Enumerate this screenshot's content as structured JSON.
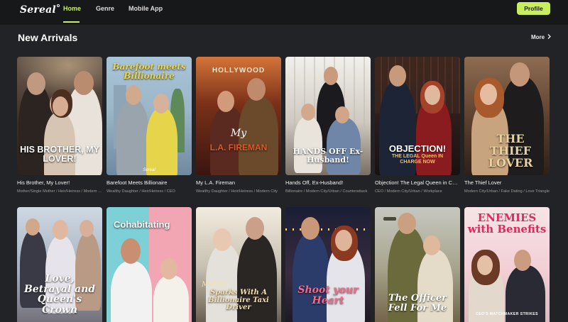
{
  "nav": {
    "logo": "Sereal",
    "links": [
      "Home",
      "Genre",
      "Mobile App"
    ],
    "active": "Home",
    "profile_label": "Profile",
    "accent": "#c8ee5e"
  },
  "section": {
    "title": "New Arrivals",
    "more_label": "More",
    "more_icon": "chevron-right-icon"
  },
  "cards": [
    {
      "title": "His Brother, My Lover!",
      "tags": "Mother/Single Mother / Heir/Heiress / Modern City",
      "cover_text": "HIS BROTHER, MY LOVER!"
    },
    {
      "title": "Barefoot Meets Billionaire",
      "tags": "Wealthy Daughter / Heir/Heiress / CEO",
      "cover_text": "Barefoot meets Billionaire",
      "cover_brand": "Sereal"
    },
    {
      "title": "My L.A. Fireman",
      "tags": "Wealthy Daughter / Heir/Heiress / Modern City",
      "cover_text": "L.A. FIREMAN",
      "cover_small": "My",
      "cover_sign": "HOLLYWOOD"
    },
    {
      "title": "Hands Off, Ex-Husband!",
      "tags": "Billionaire / Modern City/Urban / Counterattack",
      "cover_text": "HANDS OFF Ex-Husband!"
    },
    {
      "title": "Objection! The Legal Queen in Charge Now",
      "tags": "CEO / Modern City/Urban / Workplace",
      "cover_text": "OBJECTION!",
      "cover_small": "THE LEGAL Queen IN CHARGE NOW"
    },
    {
      "title": "The Thief Lover",
      "tags": "Modern City/Urban / Fake Dating / Love Triangle",
      "cover_text": "THE THIEF LOVER"
    },
    {
      "title": "",
      "tags": "",
      "cover_text": "Love, Betrayal and Queen's Crown"
    },
    {
      "title": "",
      "tags": "",
      "cover_text": "Cohabitating"
    },
    {
      "title": "",
      "tags": "",
      "cover_text": "Sparks With A Billionaire Taxi Driver",
      "cover_small": "Midlife"
    },
    {
      "title": "",
      "tags": "",
      "cover_text": "Shoot your Heart"
    },
    {
      "title": "",
      "tags": "",
      "cover_text": "The Officer Fell For Me"
    },
    {
      "title": "",
      "tags": "",
      "cover_text": "ENEMIES with Benefits",
      "cover_small": "CEO'S MATCHMAKER STRIKES"
    }
  ]
}
